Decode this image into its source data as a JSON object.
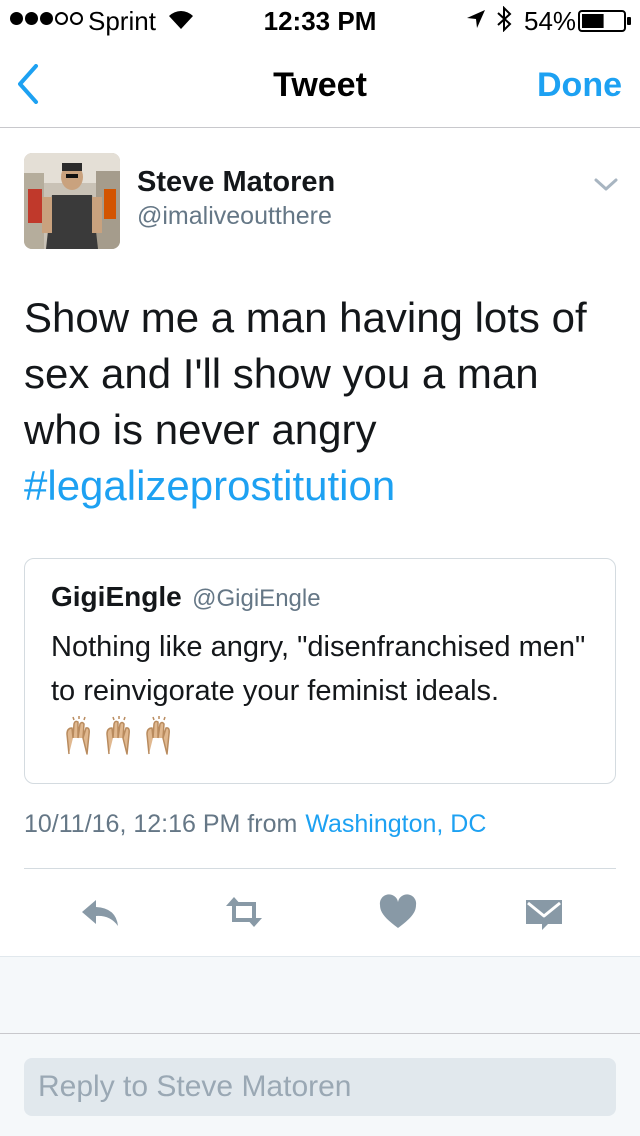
{
  "status_bar": {
    "carrier": "Sprint",
    "time": "12:33 PM",
    "battery": "54%",
    "battery_level": 0.54
  },
  "nav": {
    "title": "Tweet",
    "done_label": "Done"
  },
  "tweet": {
    "author_name": "Steve Matoren",
    "author_handle": "@imaliveoutthere",
    "text": "Show me a man having lots of sex and I'll show you a man who is never angry",
    "hashtag": "#legalizeprostitution",
    "timestamp": "10/11/16, 12:16 PM from",
    "location": "Washington, DC"
  },
  "quote": {
    "name": "GigiEngle",
    "handle": "@GigiEngle",
    "text": "Nothing like angry, \"disenfranchised men\" to reinvigorate your feminist ideals."
  },
  "reply": {
    "placeholder": "Reply to Steve Matoren"
  },
  "colors": {
    "accent": "#1da1f2",
    "secondary_text": "#657786",
    "action_icons": "#8899a6"
  }
}
